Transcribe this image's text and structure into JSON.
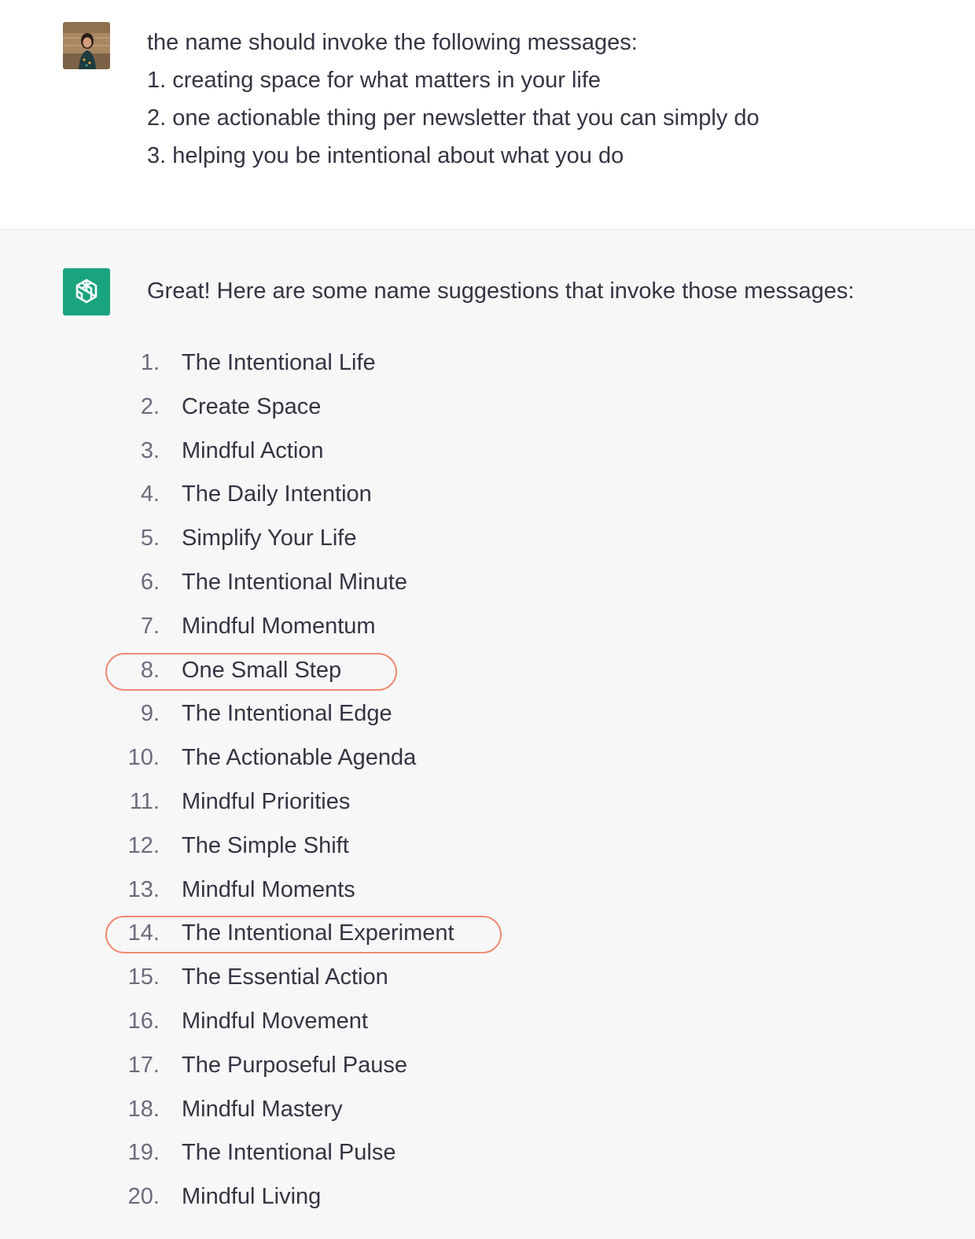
{
  "user_message": {
    "lines": [
      "the name should invoke the following messages:",
      "1. creating space for what matters in your life",
      "2. one actionable thing per newsletter that you can simply do",
      "3. helping you be intentional about what you do"
    ]
  },
  "assistant_message": {
    "intro": "Great! Here are some name suggestions that invoke those messages:",
    "items": [
      {
        "num": "1.",
        "label": "The Intentional Life"
      },
      {
        "num": "2.",
        "label": "Create Space"
      },
      {
        "num": "3.",
        "label": "Mindful Action"
      },
      {
        "num": "4.",
        "label": "The Daily Intention"
      },
      {
        "num": "5.",
        "label": "Simplify Your Life"
      },
      {
        "num": "6.",
        "label": "The Intentional Minute"
      },
      {
        "num": "7.",
        "label": "Mindful Momentum"
      },
      {
        "num": "8.",
        "label": "One Small Step"
      },
      {
        "num": "9.",
        "label": "The Intentional Edge"
      },
      {
        "num": "10.",
        "label": "The Actionable Agenda"
      },
      {
        "num": "11.",
        "label": "Mindful Priorities"
      },
      {
        "num": "12.",
        "label": "The Simple Shift"
      },
      {
        "num": "13.",
        "label": "Mindful Moments"
      },
      {
        "num": "14.",
        "label": "The Intentional Experiment"
      },
      {
        "num": "15.",
        "label": "The Essential Action"
      },
      {
        "num": "16.",
        "label": "Mindful Movement"
      },
      {
        "num": "17.",
        "label": "The Purposeful Pause"
      },
      {
        "num": "18.",
        "label": "Mindful Mastery"
      },
      {
        "num": "19.",
        "label": "The Intentional Pulse"
      },
      {
        "num": "20.",
        "label": "Mindful Living"
      }
    ]
  },
  "icons": {
    "user_avatar": "user-photo-avatar",
    "assistant_avatar": "openai-logo-icon"
  },
  "colors": {
    "assistant_bg": "#f7f7f8",
    "avatar_green": "#19a37f",
    "highlight_circle": "#ef8a73",
    "text": "#343541"
  }
}
